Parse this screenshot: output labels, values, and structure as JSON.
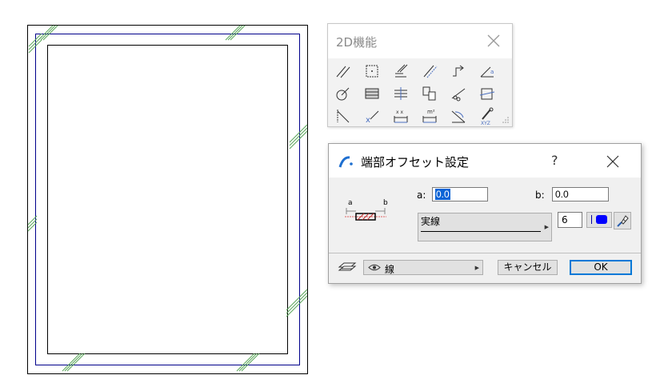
{
  "palette": {
    "title": "2D機能",
    "tools": [
      {
        "name": "line-tool-icon"
      },
      {
        "name": "rectangle-tool-icon"
      },
      {
        "name": "multiline-tool-icon"
      },
      {
        "name": "offset-lines-tool-icon"
      },
      {
        "name": "polyline-tool-icon"
      },
      {
        "name": "angle-tool-icon"
      },
      {
        "name": "circle-tool-icon"
      },
      {
        "name": "hatch-tool-icon"
      },
      {
        "name": "trim-tool-icon"
      },
      {
        "name": "copy-tool-icon"
      },
      {
        "name": "cut-tool-icon"
      },
      {
        "name": "frame-tool-icon"
      },
      {
        "name": "diagonal-tool-icon"
      },
      {
        "name": "point-tool-icon"
      },
      {
        "name": "dimension-tool-icon"
      },
      {
        "name": "area-dimension-tool-icon"
      },
      {
        "name": "angle-dimension-tool-icon"
      },
      {
        "name": "coordinate-tool-icon"
      }
    ]
  },
  "dialog": {
    "title": "端部オフセット設定",
    "help": "?",
    "diagram": {
      "a": "a",
      "b": "b"
    },
    "a_label": "a:",
    "a_value": "0.0",
    "b_label": "b:",
    "b_value": "0.0",
    "linetype": "実線",
    "pen_number": "6",
    "pen_color": "#0000ff",
    "layer": "線",
    "cancel": "キャンセル",
    "ok": "OK"
  }
}
